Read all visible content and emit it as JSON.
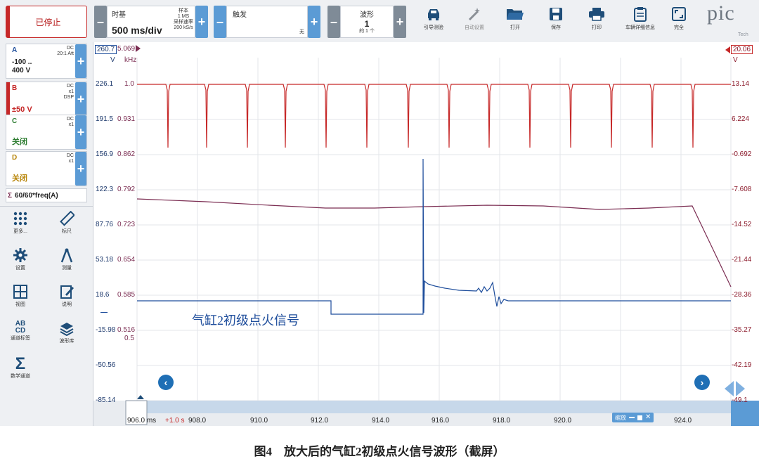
{
  "toolbar": {
    "stop_label": "已停止",
    "timebase": {
      "title": "时基",
      "value": "500 ms/div"
    },
    "samples": {
      "line1": "样本",
      "line2": "1 MS",
      "line3": "采样速率",
      "line4": "200 kS/s"
    },
    "trigger": {
      "title": "触发",
      "mode": "无"
    },
    "waveform": {
      "title": "波形",
      "number": "1",
      "of": "的 1 个"
    },
    "tools": [
      {
        "icon": "car-icon",
        "label": "引导测验"
      },
      {
        "icon": "wand-icon",
        "label": "自动设置"
      },
      {
        "icon": "folder-icon",
        "label": "打开"
      },
      {
        "icon": "save-icon",
        "label": "保存"
      },
      {
        "icon": "print-icon",
        "label": "打印"
      },
      {
        "icon": "clipboard-icon",
        "label": "车辆详细信息"
      },
      {
        "icon": "fullscreen-icon",
        "label": "完全"
      }
    ],
    "logo": "pic",
    "logo_sub": "Tech"
  },
  "channels": [
    {
      "name": "A",
      "coupling": "DC",
      "extra": "20:1 Att",
      "extra2": "",
      "value": "-100 ..",
      "value2": "400 V",
      "color": "#1f4e9c"
    },
    {
      "name": "B",
      "coupling": "DC",
      "extra": "x1",
      "extra2": "DSP",
      "value": "±50 V",
      "value2": "",
      "color": "#c62828"
    },
    {
      "name": "C",
      "coupling": "DC",
      "extra": "x1",
      "extra2": "",
      "value": "关闭",
      "value2": "",
      "color": "#2e7d32"
    },
    {
      "name": "D",
      "coupling": "DC",
      "extra": "x1",
      "extra2": "",
      "value": "关闭",
      "value2": "",
      "color": "#b8860b"
    }
  ],
  "math_channel": {
    "symbol": "Σ",
    "label": "60/60*freq(A)"
  },
  "side_tools": [
    {
      "icon": "grid-dots-icon",
      "label": "更多..."
    },
    {
      "icon": "ruler-icon",
      "label": "标尺"
    },
    {
      "icon": "gear-icon",
      "label": "设置"
    },
    {
      "icon": "measure-icon",
      "label": "测量"
    },
    {
      "icon": "views-icon",
      "label": "视图"
    },
    {
      "icon": "notes-icon",
      "label": "说明"
    },
    {
      "icon": "channel-labels-icon",
      "label": "通道标签"
    },
    {
      "icon": "library-icon",
      "label": "波形库"
    },
    {
      "icon": "sigma-icon",
      "label": "数学通道"
    }
  ],
  "plot": {
    "left_top_box": "260.7",
    "mid_top_box": "5.069",
    "left_unit": "V",
    "mid_unit": "kHz",
    "right_top_box": "20.06",
    "right_unit": "V",
    "left_ticks": [
      "226.1",
      "191.5",
      "156.9",
      "122.3",
      "87.76",
      "53.18",
      "18.6",
      "-15.98",
      "-50.56",
      "-85.14"
    ],
    "mid_ticks": [
      "1.0",
      "0.931",
      "0.862",
      "0.792",
      "0.723",
      "0.654",
      "0.585",
      "0.516",
      "0.5"
    ],
    "right_ticks": [
      "13.14",
      "6.224",
      "-0.692",
      "-7.608",
      "-14.52",
      "-21.44",
      "-28.36",
      "-35.27",
      "-42.19",
      "-49.1"
    ],
    "x_ticks": [
      "908.0",
      "910.0",
      "912.0",
      "914.0",
      "916.0",
      "918.0",
      "920.0",
      "922.0",
      "924.0"
    ],
    "x_start": "906.0",
    "x_unit": "ms",
    "x_offset": "+1.0 s",
    "annotation": "气缸2初级点火信号",
    "zoom_label": "缩放",
    "colors": {
      "blue": "#1f4e9c",
      "red": "#c62828",
      "purple": "#7b2d52",
      "accent": "#5b9bd5"
    }
  },
  "caption": "图4　放大后的气缸2初级点火信号波形（截屏）"
}
